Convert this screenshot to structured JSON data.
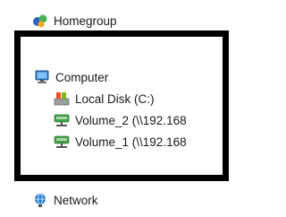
{
  "navigation_pane": {
    "items": [
      {
        "label": "Homegroup",
        "icon": "homegroup-icon"
      },
      {
        "label": "Computer",
        "icon": "computer-icon"
      },
      {
        "label": "Local Disk (C:)",
        "icon": "local-disk-icon"
      },
      {
        "label": "Volume_2 (\\\\192.168",
        "icon": "network-drive-icon"
      },
      {
        "label": "Volume_1 (\\\\192.168",
        "icon": "network-drive-icon"
      },
      {
        "label": "Network",
        "icon": "network-icon"
      }
    ]
  },
  "colors": {
    "highlight_border": "#000000",
    "homegroup_icon": "#2b63c9",
    "computer_icon": "#2f7fd0",
    "network_drive_icon": "#43a047"
  }
}
